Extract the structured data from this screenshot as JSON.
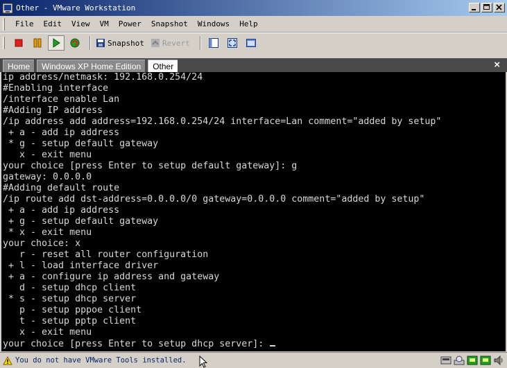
{
  "window": {
    "title": "Other - VMware Workstation",
    "controls": [
      "minimize",
      "maximize",
      "close"
    ]
  },
  "menubar": {
    "items": [
      {
        "label": "File"
      },
      {
        "label": "Edit"
      },
      {
        "label": "View"
      },
      {
        "label": "VM"
      },
      {
        "label": "Power"
      },
      {
        "label": "Snapshot"
      },
      {
        "label": "Windows"
      },
      {
        "label": "Help"
      }
    ]
  },
  "toolbar": {
    "stop_icon": "stop-icon",
    "pause_icon": "pause-icon",
    "play_icon": "play-icon",
    "reset_icon": "reset-icon",
    "snapshot_label": "Snapshot",
    "revert_label": "Revert",
    "colors": {
      "stop": "#e02020",
      "pause": "#e0a000",
      "play": "#20a020"
    }
  },
  "tabs": {
    "items": [
      {
        "label": "Home"
      },
      {
        "label": "Windows XP Home Edition"
      },
      {
        "label": "Other"
      }
    ],
    "active": "Other",
    "close_label": "×"
  },
  "console": {
    "lines": [
      "ip address/netmask: 192.168.0.254/24",
      "#Enabling interface",
      "/interface enable Lan",
      "#Adding IP address",
      "/ip address add address=192.168.0.254/24 interface=Lan comment=\"added by setup\"",
      " + a - add ip address",
      " * g - setup default gateway",
      "   x - exit menu",
      "your choice [press Enter to setup default gateway]: g",
      "gateway: 0.0.0.0",
      "#Adding default route",
      "/ip route add dst-address=0.0.0.0/0 gateway=0.0.0.0 comment=\"added by setup\"",
      " + a - add ip address",
      " + g - setup default gateway",
      " * x - exit menu",
      "your choice: x",
      "   r - reset all router configuration",
      " + l - load interface driver",
      " + a - configure ip address and gateway",
      "   d - setup dhcp client",
      " * s - setup dhcp server",
      "   p - setup pppoe client",
      "   t - setup pptp client",
      "   x - exit menu",
      "your choice [press Enter to setup dhcp server]: "
    ]
  },
  "statusbar": {
    "message": "You do not have VMware Tools installed.",
    "warning_icon": "warning-icon",
    "device_icons": [
      "floppy-icon",
      "cdrom-icon",
      "network-icon",
      "network-icon",
      "sound-icon"
    ]
  }
}
